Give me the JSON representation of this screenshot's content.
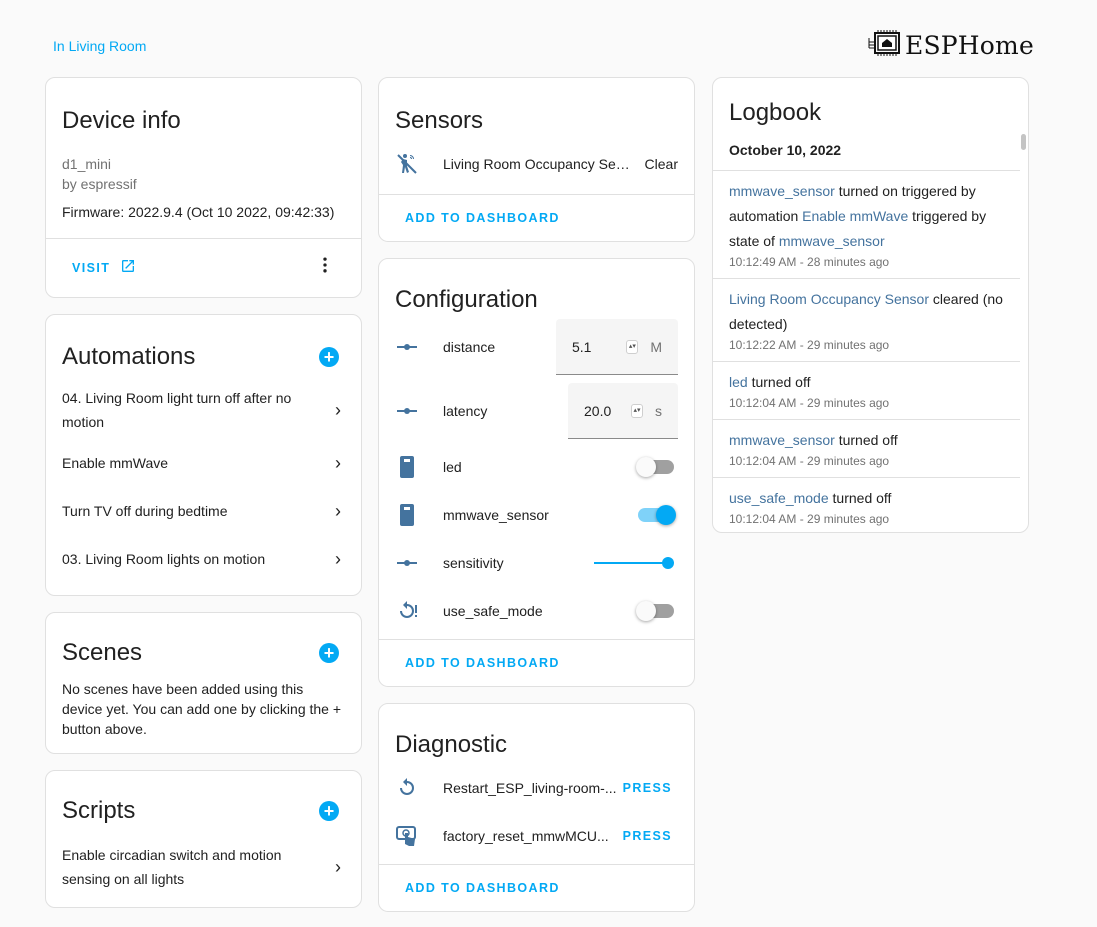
{
  "breadcrumb": "In Living Room",
  "brand": {
    "name": "ESPHome",
    "icon": "esphome-chip-icon"
  },
  "device_info": {
    "title": "Device info",
    "model": "d1_mini",
    "manufacturer": "by espressif",
    "firmware": "Firmware: 2022.9.4 (Oct 10 2022, 09:42:33)",
    "visit_label": "VISIT",
    "visit_icon": "open-in-new-icon",
    "menu_icon": "dots-vertical-icon"
  },
  "automations": {
    "title": "Automations",
    "add_icon": "plus-circle-icon",
    "items": [
      {
        "label": "04. Living Room light turn off after no motion"
      },
      {
        "label": "Enable mmWave"
      },
      {
        "label": "Turn TV off during bedtime"
      },
      {
        "label": "03. Living Room lights on motion"
      }
    ]
  },
  "scenes": {
    "title": "Scenes",
    "add_icon": "plus-circle-icon",
    "empty_text": "No scenes have been added using this device yet. You can add one by clicking the + button above."
  },
  "scripts": {
    "title": "Scripts",
    "add_icon": "plus-circle-icon",
    "items": [
      {
        "label": "Enable circadian switch and motion sensing on all lights"
      }
    ]
  },
  "sensors": {
    "title": "Sensors",
    "items": [
      {
        "icon": "motion-sensor-off-icon",
        "name": "Living Room Occupancy Sensor",
        "state": "Clear"
      }
    ],
    "add_to_dashboard": "ADD TO DASHBOARD"
  },
  "configuration": {
    "title": "Configuration",
    "distance": {
      "icon": "ray-vertex-icon",
      "name": "distance",
      "value": "5.1",
      "unit": "M"
    },
    "latency": {
      "icon": "ray-vertex-icon",
      "name": "latency",
      "value": "20.0",
      "unit": "s"
    },
    "led": {
      "icon": "light-switch-icon",
      "name": "led",
      "on": false
    },
    "mmwave_sensor": {
      "icon": "light-switch-icon",
      "name": "mmwave_sensor",
      "on": true
    },
    "sensitivity": {
      "icon": "ray-vertex-icon",
      "name": "sensitivity",
      "value_fraction": 1.0
    },
    "use_safe_mode": {
      "icon": "restart-alert-icon",
      "name": "use_safe_mode",
      "on": false
    },
    "add_to_dashboard": "ADD TO DASHBOARD"
  },
  "diagnostic": {
    "title": "Diagnostic",
    "items": [
      {
        "icon": "restart-icon",
        "name": "Restart_ESP_living-room-mmwave",
        "display_name": "Restart_ESP_living-room-...",
        "action": "PRESS"
      },
      {
        "icon": "gesture-tap-button-icon",
        "name": "factory_reset_mmwMCU",
        "display_name": "factory_reset_mmwMCU...",
        "action": "PRESS"
      }
    ],
    "add_to_dashboard": "ADD TO DASHBOARD"
  },
  "logbook": {
    "title": "Logbook",
    "date": "October 10, 2022",
    "entries": [
      {
        "parts": [
          {
            "link": "mmwave_sensor"
          },
          {
            "text": " turned on triggered by automation "
          },
          {
            "link": "Enable mmWave"
          },
          {
            "text": " triggered by state of "
          },
          {
            "link": "mmwave_sensor"
          }
        ],
        "time": "10:12:49 AM - 28 minutes ago"
      },
      {
        "parts": [
          {
            "link": "Living Room Occupancy Sensor"
          },
          {
            "text": " cleared (no detected)"
          }
        ],
        "time": "10:12:22 AM - 29 minutes ago"
      },
      {
        "parts": [
          {
            "link": "led"
          },
          {
            "text": " turned off"
          }
        ],
        "time": "10:12:04 AM - 29 minutes ago"
      },
      {
        "parts": [
          {
            "link": "mmwave_sensor"
          },
          {
            "text": " turned off"
          }
        ],
        "time": "10:12:04 AM - 29 minutes ago"
      },
      {
        "parts": [
          {
            "link": "use_safe_mode"
          },
          {
            "text": " turned off"
          }
        ],
        "time": "10:12:04 AM - 29 minutes ago"
      }
    ]
  },
  "colors": {
    "accent": "#03a9f4",
    "entity_icon": "#44739e",
    "entity_link": "#44739e",
    "background": "#fafafa",
    "card": "#ffffff"
  }
}
